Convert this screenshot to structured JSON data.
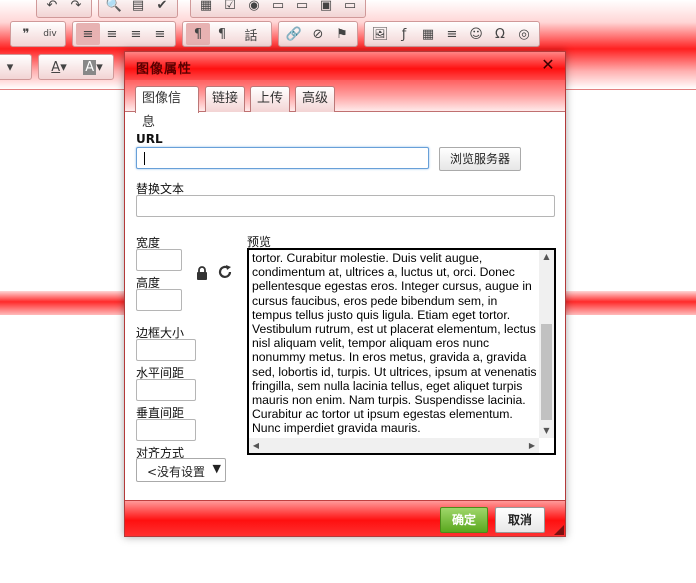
{
  "toolbar": {
    "row0": [
      "↶",
      "↷",
      "🔍",
      "▤",
      "✔",
      "▦",
      "☑",
      "◉",
      "▭",
      "▭",
      "▣",
      "▭"
    ],
    "row1_group1": [
      "❞",
      "div"
    ],
    "row1_group2": [
      "≡",
      "≡",
      "≡",
      "≡"
    ],
    "row1_group3": [
      "¶",
      "¶",
      "話"
    ],
    "row1_group4": [
      "🔗",
      "⊘",
      "⚑"
    ],
    "row1_group5": [
      "🖼",
      "ƒ",
      "▦",
      "≡",
      "☺",
      "Ω",
      "◎"
    ],
    "row2_group1": [
      "A",
      "A"
    ]
  },
  "dialog": {
    "title": "图像属性",
    "close": "✕",
    "tabs": [
      "图像信息",
      "链接",
      "上传",
      "高级"
    ],
    "url_label": "URL",
    "url_value": "",
    "browse_button": "浏览服务器",
    "alt_label": "替换文本",
    "alt_value": "",
    "width_label": "宽度",
    "height_label": "高度",
    "border_label": "边框大小",
    "hspace_label": "水平间距",
    "vspace_label": "垂直间距",
    "align_label": "对齐方式",
    "align_value": "<没有设置>",
    "preview_label": "预览",
    "preview_lines": [
      "tortor. Curabitur molestie. Duis velit augue,",
      "condimentum at, ultrices a, luctus ut, orci. Donec",
      "pellentesque egestas eros. Integer cursus, augue in",
      "cursus faucibus, eros pede bibendum sem, in",
      "tempus tellus justo quis ligula. Etiam eget tortor.",
      "Vestibulum rutrum, est ut placerat elementum, lectus",
      "nisl aliquam velit, tempor aliquam eros nunc",
      "nonummy metus. In eros metus, gravida a, gravida",
      "sed, lobortis id, turpis. Ut ultrices, ipsum at venenatis",
      "fringilla, sem nulla lacinia tellus, eget aliquet turpis",
      "mauris non enim. Nam turpis. Suspendisse lacinia.",
      "Curabitur ac tortor ut ipsum egestas elementum.",
      "Nunc imperdiet gravida mauris."
    ],
    "ok_button": "确定",
    "cancel_button": "取消"
  },
  "colors": {
    "accent": "#ff1010",
    "ok_green": "#5aa81e"
  }
}
